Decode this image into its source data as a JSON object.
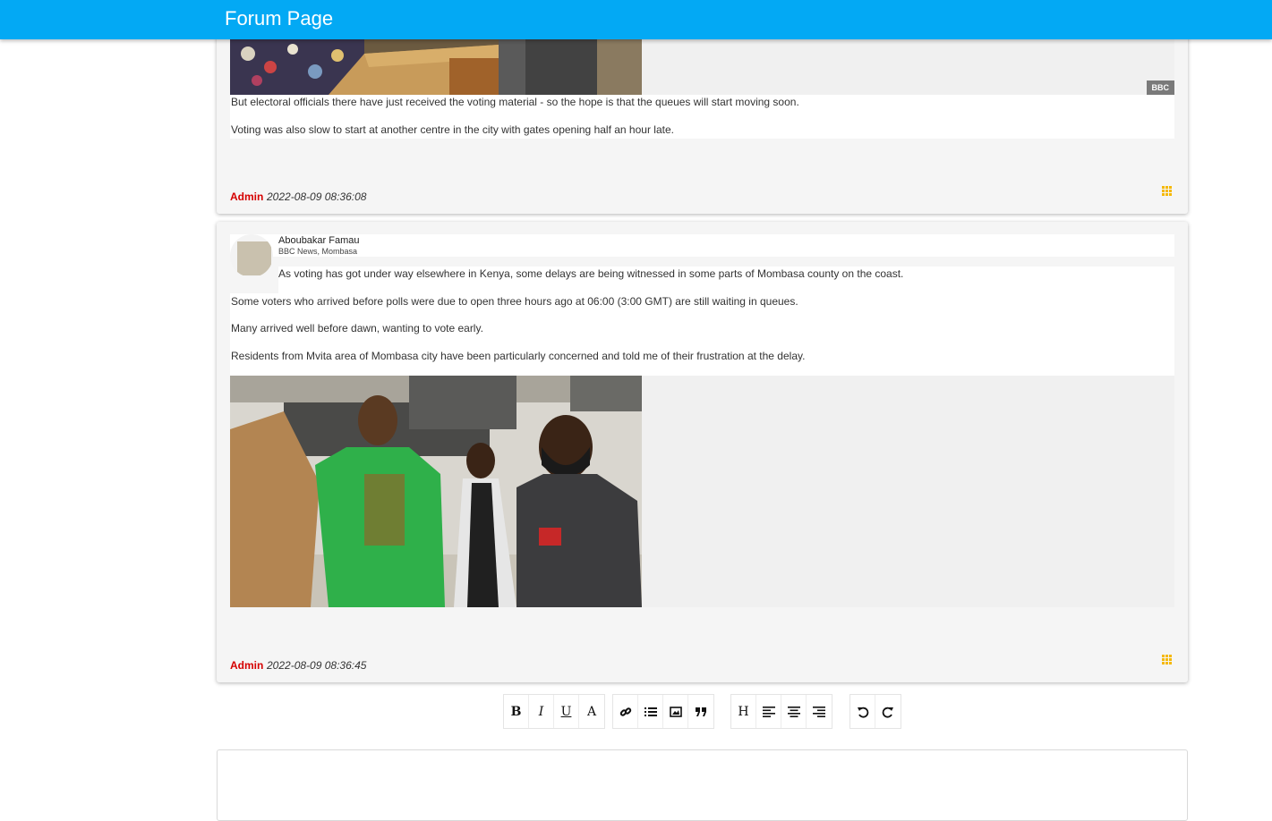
{
  "app": {
    "title": "Forum Page"
  },
  "posts": [
    {
      "image_credit": "BBC",
      "paragraphs": [
        "But electoral officials there have just received the voting material - so the hope is that the queues will start moving soon.",
        "Voting was also slow to start at another centre in the city with gates opening half an hour late."
      ],
      "footer": {
        "author": "Admin",
        "timestamp": "2022-08-09 08:36:08"
      },
      "menu_icon": "grid-menu-icon"
    },
    {
      "author": {
        "name": "Aboubakar Famau",
        "subtitle": "BBC News, Mombasa"
      },
      "paragraphs": [
        "As voting has got under way elsewhere in Kenya, some delays are being witnessed in some parts of Mombasa county on the coast.",
        "Some voters who arrived before polls were due to open three hours ago at 06:00 (3:00 GMT) are still waiting in queues.",
        "Many arrived well before dawn, wanting to vote early.",
        "Residents from Mvita area of Mombasa city have been particularly concerned and told me of their frustration at the delay."
      ],
      "footer": {
        "author": "Admin",
        "timestamp": "2022-08-09 08:36:45"
      },
      "menu_icon": "grid-menu-icon"
    }
  ],
  "toolbar": {
    "bold": "B",
    "italic": "I",
    "underline": "U",
    "font_color": "A",
    "heading": "H",
    "icons": [
      "link-icon",
      "list-icon",
      "image-icon",
      "quote-icon",
      "align-left-icon",
      "align-center-icon",
      "align-right-icon",
      "undo-icon",
      "redo-icon"
    ]
  },
  "colors": {
    "appbar": "#03a9f4",
    "author": "#d50000",
    "menu_icon": "#f5b800"
  }
}
